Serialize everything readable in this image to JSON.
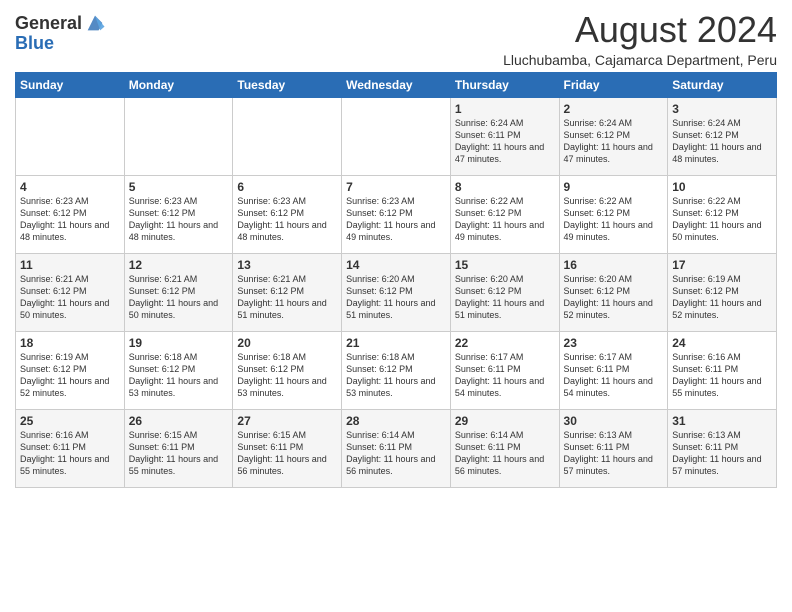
{
  "logo": {
    "general": "General",
    "blue": "Blue"
  },
  "title": "August 2024",
  "subtitle": "Lluchubamba, Cajamarca Department, Peru",
  "days_of_week": [
    "Sunday",
    "Monday",
    "Tuesday",
    "Wednesday",
    "Thursday",
    "Friday",
    "Saturday"
  ],
  "weeks": [
    [
      {
        "day": "",
        "info": ""
      },
      {
        "day": "",
        "info": ""
      },
      {
        "day": "",
        "info": ""
      },
      {
        "day": "",
        "info": ""
      },
      {
        "day": "1",
        "info": "Sunrise: 6:24 AM\nSunset: 6:11 PM\nDaylight: 11 hours and 47 minutes."
      },
      {
        "day": "2",
        "info": "Sunrise: 6:24 AM\nSunset: 6:12 PM\nDaylight: 11 hours and 47 minutes."
      },
      {
        "day": "3",
        "info": "Sunrise: 6:24 AM\nSunset: 6:12 PM\nDaylight: 11 hours and 48 minutes."
      }
    ],
    [
      {
        "day": "4",
        "info": "Sunrise: 6:23 AM\nSunset: 6:12 PM\nDaylight: 11 hours and 48 minutes."
      },
      {
        "day": "5",
        "info": "Sunrise: 6:23 AM\nSunset: 6:12 PM\nDaylight: 11 hours and 48 minutes."
      },
      {
        "day": "6",
        "info": "Sunrise: 6:23 AM\nSunset: 6:12 PM\nDaylight: 11 hours and 48 minutes."
      },
      {
        "day": "7",
        "info": "Sunrise: 6:23 AM\nSunset: 6:12 PM\nDaylight: 11 hours and 49 minutes."
      },
      {
        "day": "8",
        "info": "Sunrise: 6:22 AM\nSunset: 6:12 PM\nDaylight: 11 hours and 49 minutes."
      },
      {
        "day": "9",
        "info": "Sunrise: 6:22 AM\nSunset: 6:12 PM\nDaylight: 11 hours and 49 minutes."
      },
      {
        "day": "10",
        "info": "Sunrise: 6:22 AM\nSunset: 6:12 PM\nDaylight: 11 hours and 50 minutes."
      }
    ],
    [
      {
        "day": "11",
        "info": "Sunrise: 6:21 AM\nSunset: 6:12 PM\nDaylight: 11 hours and 50 minutes."
      },
      {
        "day": "12",
        "info": "Sunrise: 6:21 AM\nSunset: 6:12 PM\nDaylight: 11 hours and 50 minutes."
      },
      {
        "day": "13",
        "info": "Sunrise: 6:21 AM\nSunset: 6:12 PM\nDaylight: 11 hours and 51 minutes."
      },
      {
        "day": "14",
        "info": "Sunrise: 6:20 AM\nSunset: 6:12 PM\nDaylight: 11 hours and 51 minutes."
      },
      {
        "day": "15",
        "info": "Sunrise: 6:20 AM\nSunset: 6:12 PM\nDaylight: 11 hours and 51 minutes."
      },
      {
        "day": "16",
        "info": "Sunrise: 6:20 AM\nSunset: 6:12 PM\nDaylight: 11 hours and 52 minutes."
      },
      {
        "day": "17",
        "info": "Sunrise: 6:19 AM\nSunset: 6:12 PM\nDaylight: 11 hours and 52 minutes."
      }
    ],
    [
      {
        "day": "18",
        "info": "Sunrise: 6:19 AM\nSunset: 6:12 PM\nDaylight: 11 hours and 52 minutes."
      },
      {
        "day": "19",
        "info": "Sunrise: 6:18 AM\nSunset: 6:12 PM\nDaylight: 11 hours and 53 minutes."
      },
      {
        "day": "20",
        "info": "Sunrise: 6:18 AM\nSunset: 6:12 PM\nDaylight: 11 hours and 53 minutes."
      },
      {
        "day": "21",
        "info": "Sunrise: 6:18 AM\nSunset: 6:12 PM\nDaylight: 11 hours and 53 minutes."
      },
      {
        "day": "22",
        "info": "Sunrise: 6:17 AM\nSunset: 6:11 PM\nDaylight: 11 hours and 54 minutes."
      },
      {
        "day": "23",
        "info": "Sunrise: 6:17 AM\nSunset: 6:11 PM\nDaylight: 11 hours and 54 minutes."
      },
      {
        "day": "24",
        "info": "Sunrise: 6:16 AM\nSunset: 6:11 PM\nDaylight: 11 hours and 55 minutes."
      }
    ],
    [
      {
        "day": "25",
        "info": "Sunrise: 6:16 AM\nSunset: 6:11 PM\nDaylight: 11 hours and 55 minutes."
      },
      {
        "day": "26",
        "info": "Sunrise: 6:15 AM\nSunset: 6:11 PM\nDaylight: 11 hours and 55 minutes."
      },
      {
        "day": "27",
        "info": "Sunrise: 6:15 AM\nSunset: 6:11 PM\nDaylight: 11 hours and 56 minutes."
      },
      {
        "day": "28",
        "info": "Sunrise: 6:14 AM\nSunset: 6:11 PM\nDaylight: 11 hours and 56 minutes."
      },
      {
        "day": "29",
        "info": "Sunrise: 6:14 AM\nSunset: 6:11 PM\nDaylight: 11 hours and 56 minutes."
      },
      {
        "day": "30",
        "info": "Sunrise: 6:13 AM\nSunset: 6:11 PM\nDaylight: 11 hours and 57 minutes."
      },
      {
        "day": "31",
        "info": "Sunrise: 6:13 AM\nSunset: 6:11 PM\nDaylight: 11 hours and 57 minutes."
      }
    ]
  ]
}
